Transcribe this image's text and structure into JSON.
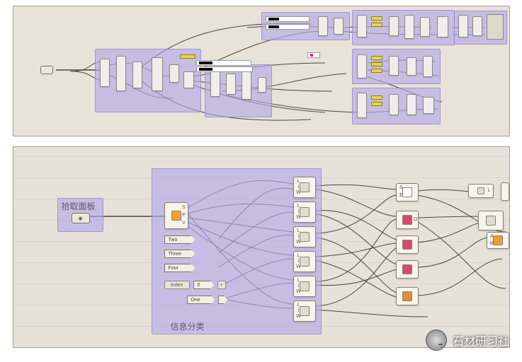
{
  "top_panel": {
    "description": "Grasshopper node graph - overview"
  },
  "bottom_panel": {
    "group_pick_label": "拾取面板",
    "group_classify_label": "信息分类",
    "param_labels": {
      "two": "Two",
      "three": "Three",
      "four": "Four",
      "index": "Index",
      "one": "One",
      "zero": "0"
    },
    "bignode_ports": {
      "l_top": "L",
      "i_mid": "i",
      "w_bot": "W",
      "out_l": "L",
      "s": "S",
      "e": "E",
      "p": "P",
      "o": "O",
      "m": "M",
      "a": "A"
    }
  },
  "watermark": "石材研习社"
}
